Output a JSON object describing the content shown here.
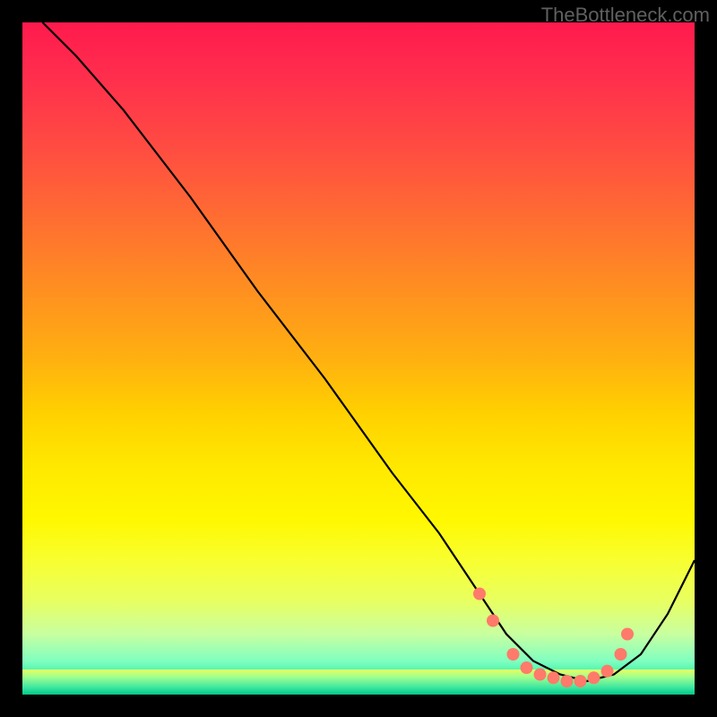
{
  "watermark": "TheBottleneck.com",
  "chart_data": {
    "type": "line",
    "title": "",
    "xlabel": "",
    "ylabel": "",
    "xlim": [
      0,
      100
    ],
    "ylim": [
      0,
      100
    ],
    "series": [
      {
        "name": "bottleneck-curve",
        "x": [
          3,
          8,
          15,
          25,
          35,
          45,
          55,
          62,
          68,
          72,
          76,
          80,
          84,
          88,
          92,
          96,
          100
        ],
        "y": [
          100,
          95,
          87,
          74,
          60,
          47,
          33,
          24,
          15,
          9,
          5,
          3,
          2,
          3,
          6,
          12,
          20
        ]
      }
    ],
    "markers": {
      "name": "optimal-zone-dots",
      "x": [
        68,
        70,
        73,
        75,
        77,
        79,
        81,
        83,
        85,
        87,
        89,
        90
      ],
      "y": [
        15,
        11,
        6,
        4,
        3,
        2.5,
        2,
        2,
        2.5,
        3.5,
        6,
        9
      ]
    }
  }
}
